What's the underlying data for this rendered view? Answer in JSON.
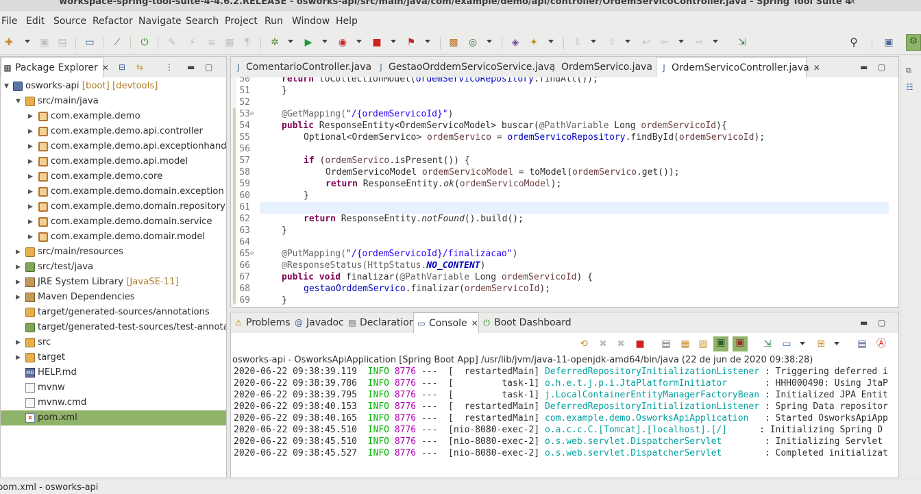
{
  "window": {
    "title": "workspace-spring-tool-suite-4-4.6.2.RELEASE - osworks-api/src/main/java/com/example/demo/api/controller/OrdemServicoController.java - Spring Tool Suite 4",
    "close": "×"
  },
  "menu": [
    "File",
    "Edit",
    "Source",
    "Refactor",
    "Navigate",
    "Search",
    "Project",
    "Run",
    "Window",
    "Help"
  ],
  "package_explorer": {
    "title": "Package Explorer",
    "items": [
      {
        "label": "osworks-api",
        "deco": " [boot] [devtools]"
      },
      {
        "label": "src/main/java",
        "deco": ""
      },
      {
        "label": "com.example.demo",
        "deco": ""
      },
      {
        "label": "com.example.demo.api.controller",
        "deco": ""
      },
      {
        "label": "com.example.demo.api.exceptionhandler",
        "deco": ""
      },
      {
        "label": "com.example.demo.api.model",
        "deco": ""
      },
      {
        "label": "com.example.demo.core",
        "deco": ""
      },
      {
        "label": "com.example.demo.domain.exception",
        "deco": ""
      },
      {
        "label": "com.example.demo.domain.repository",
        "deco": ""
      },
      {
        "label": "com.example.demo.domain.service",
        "deco": ""
      },
      {
        "label": "com.example.demo.domair.model",
        "deco": ""
      },
      {
        "label": "src/main/resources",
        "deco": ""
      },
      {
        "label": "src/test/java",
        "deco": ""
      },
      {
        "label": "JRE System Library",
        "deco": " [JavaSE-11]"
      },
      {
        "label": "Maven Dependencies",
        "deco": ""
      },
      {
        "label": "target/generated-sources/annotations",
        "deco": ""
      },
      {
        "label": "target/generated-test-sources/test-annotations",
        "deco": ""
      },
      {
        "label": "src",
        "deco": ""
      },
      {
        "label": "target",
        "deco": ""
      },
      {
        "label": "HELP.md",
        "deco": ""
      },
      {
        "label": "mvnw",
        "deco": ""
      },
      {
        "label": "mvnw.cmd",
        "deco": ""
      },
      {
        "label": "pom.xml",
        "deco": ""
      }
    ]
  },
  "editor": {
    "tabs": [
      {
        "label": "ComentarioController.java"
      },
      {
        "label": "GestaoOrddemServicoService.java"
      },
      {
        "label": "OrdemServico.java"
      },
      {
        "label": "OrdemServicoController.java"
      }
    ],
    "line_numbers": [
      "50",
      "51",
      "52",
      "53",
      "54",
      "55",
      "56",
      "57",
      "58",
      "59",
      "60",
      "61",
      "62",
      "63",
      "64",
      "65",
      "66",
      "67",
      "68",
      "69"
    ],
    "lines": {
      "l50": "return toCollectionModel(ordemServicoRepository.findAll());",
      "l51": "}",
      "l53a": "@GetMapping(",
      "l53b": "\"/{ordemServicoId}\"",
      "l53c": ")",
      "l54a": "public",
      "l54b": " ResponseEntity<OrdemServicoModel> buscar(",
      "l54c": "@PathVariable",
      "l54d": " Long ",
      "l54e": "ordemServicoId",
      "l54f": "){",
      "l55a": "Optional<OrdemServico> ",
      "l55b": "ordemServico",
      "l55c": " = ",
      "l55d": "ordemServicoRepository",
      "l55e": ".findById(",
      "l55f": "ordemServicoId",
      "l55g": ");",
      "l57a": "if",
      "l57b": " (",
      "l57c": "ordemServico",
      "l57d": ".isPresent()) {",
      "l58a": "OrdemServicoModel ",
      "l58b": "ordemServicoModel",
      "l58c": " = toModel(",
      "l58d": "ordemServico",
      "l58e": ".get());",
      "l59a": "return",
      "l59b": " ResponseEntity.",
      "l59c": "ok",
      "l59d": "(",
      "l59e": "ordemServicoModel",
      "l59f": ");",
      "l60": "}",
      "l62a": "return",
      "l62b": " ResponseEntity.",
      "l62c": "notFound",
      "l62d": "().build();",
      "l63": "}",
      "l65a": "@PutMapping(",
      "l65b": "\"/{ordemServicoId}/finalizacao\"",
      "l65c": ")",
      "l66a": "@ResponseStatus(HttpStatus.",
      "l66b": "NO_CONTENT",
      "l66c": ")",
      "l67a": "public",
      "l67b": "void",
      "l67c": " finalizar(",
      "l67d": "@PathVariable",
      "l67e": " Long ",
      "l67f": "ordemServicoId",
      "l67g": ") {",
      "l68a": "gestaoOrddemServico",
      "l68b": ".finalizar(",
      "l68c": "ordemServicoId",
      "l68d": ");",
      "l69": "}"
    }
  },
  "bottom_panel": {
    "tabs": [
      {
        "label": "Problems"
      },
      {
        "label": "Javadoc"
      },
      {
        "label": "Declaration"
      },
      {
        "label": "Console"
      },
      {
        "label": "Boot Dashboard"
      }
    ],
    "console_header": "osworks-api - OsworksApiApplication [Spring Boot App] /usr/lib/jvm/java-11-openjdk-amd64/bin/java  (22 de jun de 2020 09:38:28)",
    "rows": [
      {
        "ts": "2020-06-22 09:38:39.119",
        "level": "INFO",
        "pid": "8776",
        "thread": "---  [  restartedMain]",
        "logger": "DeferredRepositoryInitializationListener",
        "msg": " : Triggering deferred i"
      },
      {
        "ts": "2020-06-22 09:38:39.786",
        "level": "INFO",
        "pid": "8776",
        "thread": "---  [         task-1]",
        "logger": "o.h.e.t.j.p.i.JtaPlatformInitiator      ",
        "msg": " : HHH000490: Using JtaP"
      },
      {
        "ts": "2020-06-22 09:38:39.795",
        "level": "INFO",
        "pid": "8776",
        "thread": "---  [         task-1]",
        "logger": "j.LocalContainerEntityManagerFactoryBean",
        "msg": " : Initialized JPA Entit"
      },
      {
        "ts": "2020-06-22 09:38:40.153",
        "level": "INFO",
        "pid": "8776",
        "thread": "---  [  restartedMain]",
        "logger": "DeferredRepositoryInitializationListener",
        "msg": " : Spring Data repositor"
      },
      {
        "ts": "2020-06-22 09:38:40.165",
        "level": "INFO",
        "pid": "8776",
        "thread": "---  [  restartedMain]",
        "logger": "com.example.demo.OsworksApiApplication  ",
        "msg": " : Started OsworksApiApp"
      },
      {
        "ts": "2020-06-22 09:38:45.510",
        "level": "INFO",
        "pid": "8776",
        "thread": "---  [nio-8080-exec-2]",
        "logger": "o.a.c.c.C.[Tomcat].[localhost].[/]     ",
        "msg": " : Initializing Spring D"
      },
      {
        "ts": "2020-06-22 09:38:45.510",
        "level": "INFO",
        "pid": "8776",
        "thread": "---  [nio-8080-exec-2]",
        "logger": "o.s.web.servlet.DispatcherServlet       ",
        "msg": " : Initializing Servlet "
      },
      {
        "ts": "2020-06-22 09:38:45.527",
        "level": "INFO",
        "pid": "8776",
        "thread": "---  [nio-8080-exec-2]",
        "logger": "o.s.web.servlet.DispatcherServlet       ",
        "msg": " : Completed initializat"
      }
    ]
  },
  "status_bar": {
    "text": "pom.xml - osworks-api"
  },
  "colors": {
    "selection": "#8fb368",
    "current_line": "#e8f2fe",
    "keyword": "#7f0055",
    "string": "#2a00ff",
    "field": "#0000c0",
    "info": "#00b300"
  }
}
